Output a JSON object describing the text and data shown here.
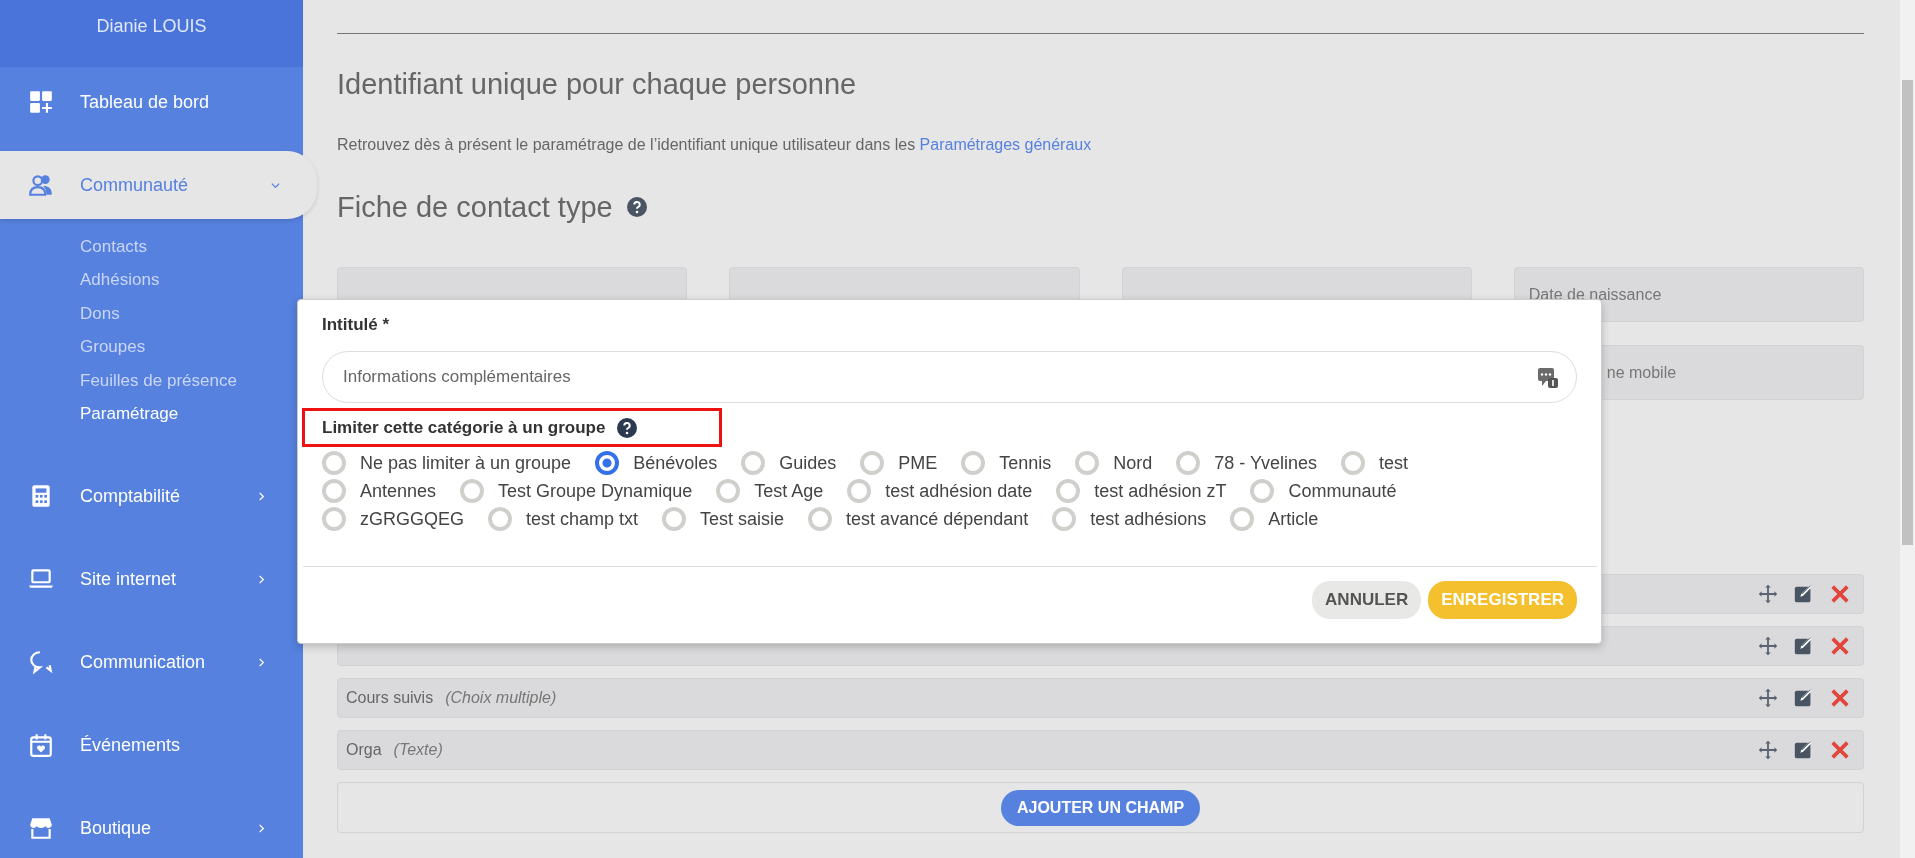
{
  "sidebar": {
    "user": "Dianie LOUIS",
    "items": [
      {
        "label": "Tableau de bord",
        "selected": false
      },
      {
        "label": "Communauté",
        "selected": true,
        "expanded": true,
        "children": [
          {
            "label": "Contacts",
            "selected": false
          },
          {
            "label": "Adhésions",
            "selected": false
          },
          {
            "label": "Dons",
            "selected": false
          },
          {
            "label": "Groupes",
            "selected": false
          },
          {
            "label": "Feuilles de présence",
            "selected": false
          },
          {
            "label": "Paramétrage",
            "selected": true
          }
        ]
      },
      {
        "label": "Comptabilité",
        "selected": false,
        "expanded": false
      },
      {
        "label": "Site internet",
        "selected": false,
        "expanded": false
      },
      {
        "label": "Communication",
        "selected": false,
        "expanded": false
      },
      {
        "label": "Événements",
        "selected": false
      },
      {
        "label": "Boutique",
        "selected": false,
        "expanded": false
      }
    ]
  },
  "main": {
    "heading": "Identifiant unique pour chaque personne",
    "intro": {
      "text": "Retrouvez dès à présent le paramétrage de l’identifiant unique utilisateur dans les",
      "link": "Paramétrages généraux"
    },
    "section_title": "Fiche de contact type",
    "fixed_fields": [
      {
        "label": "Date de naissance"
      },
      {
        "label": "ne mobile"
      }
    ],
    "custom_fields": [
      {
        "kind": "covered"
      },
      {
        "kind": "covered"
      },
      {
        "kind": "field",
        "label": "Cours suivis",
        "type": "(Choix multiple)"
      },
      {
        "kind": "field",
        "label": "Orga",
        "type": "(Texte)"
      }
    ],
    "add_button": "AJOUTER UN CHAMP"
  },
  "modal": {
    "title_label": "Intitulé *",
    "title_value": "Informations complémentaires",
    "group_label": "Limiter cette catégorie à un groupe",
    "group_label_highlighted": true,
    "groups": [
      {
        "label": "Ne pas limiter à un groupe",
        "selected": false
      },
      {
        "label": "Bénévoles",
        "selected": true
      },
      {
        "label": "Guides",
        "selected": false
      },
      {
        "label": "PME",
        "selected": false
      },
      {
        "label": "Tennis",
        "selected": false
      },
      {
        "label": "Nord",
        "selected": false
      },
      {
        "label": "78 - Yvelines",
        "selected": false
      },
      {
        "label": "test",
        "selected": false
      },
      {
        "label": "Antennes",
        "selected": false
      },
      {
        "label": "Test Groupe Dynamique",
        "selected": false
      },
      {
        "label": "Test Age",
        "selected": false
      },
      {
        "label": "test adhésion date",
        "selected": false
      },
      {
        "label": "test adhésion zT",
        "selected": false
      },
      {
        "label": "Communauté",
        "selected": false
      },
      {
        "label": "zGRGGQEG",
        "selected": false
      },
      {
        "label": "test champ txt",
        "selected": false
      },
      {
        "label": "Test saisie",
        "selected": false
      },
      {
        "label": "test avancé dépendant",
        "selected": false
      },
      {
        "label": "test adhésions",
        "selected": false
      },
      {
        "label": "Article",
        "selected": false
      }
    ],
    "buttons": [
      {
        "label": "ANNULER",
        "kind": "secondary"
      },
      {
        "label": "ENREGISTRER",
        "kind": "primary"
      }
    ]
  }
}
